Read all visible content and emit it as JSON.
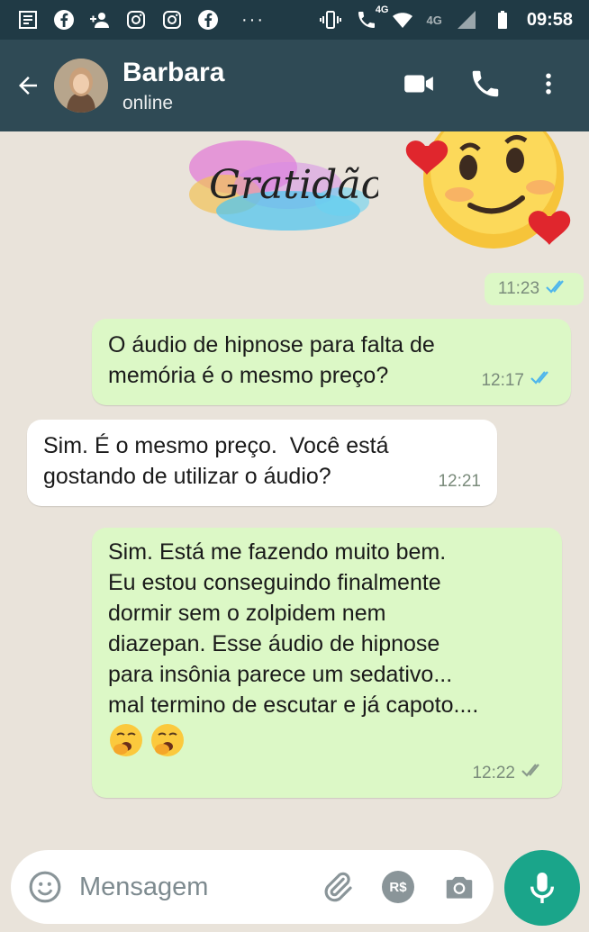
{
  "status_bar": {
    "time": "09:58",
    "network_label": "4G",
    "network_label_2": "4G",
    "overflow_indicator": "···",
    "icons": [
      "notes-icon",
      "facebook-icon",
      "add-contact-icon",
      "instagram-icon",
      "instagram-icon",
      "facebook-icon",
      "vibrate-icon",
      "wifi-calling-icon",
      "wifi-icon",
      "signal-icon",
      "battery-icon"
    ]
  },
  "header": {
    "contact_name": "Barbara",
    "contact_status": "online",
    "actions": [
      "video-call-icon",
      "voice-call-icon",
      "more-options-icon"
    ]
  },
  "chat": {
    "sticker_text": "Gratidão",
    "sticker_time": "11:23",
    "messages": [
      {
        "direction": "outgoing",
        "lines": [
          "O áudio de hipnose para falta de",
          "memória é o mesmo preço?"
        ],
        "time": "12:17",
        "status": "read"
      },
      {
        "direction": "incoming",
        "lines": [
          "Sim. É o mesmo preço.  Você está",
          "gostando de utilizar o áudio?"
        ],
        "time": "12:21"
      },
      {
        "direction": "outgoing",
        "lines": [
          "Sim. Está me fazendo muito bem.",
          "Eu estou conseguindo finalmente",
          "dormir sem o zolpidem nem",
          "diazepan. Esse áudio de hipnose",
          "para insônia parece um sedativo...",
          "mal termino de escutar e já capoto...."
        ],
        "emojis": [
          "yawning-face",
          "yawning-face"
        ],
        "time": "12:22",
        "status": "delivered"
      }
    ]
  },
  "composer": {
    "placeholder": "Mensagem",
    "payment_label": "R$"
  },
  "colors": {
    "header": "#2f4a55",
    "status_bar": "#203a45",
    "outgoing_bubble": "#dcf8c6",
    "incoming_bubble": "#ffffff",
    "chat_background": "#e9e3da",
    "mic_button": "#1aa58a",
    "read_tick": "#4fb6ec",
    "delivered_tick": "#8a9a8c"
  }
}
